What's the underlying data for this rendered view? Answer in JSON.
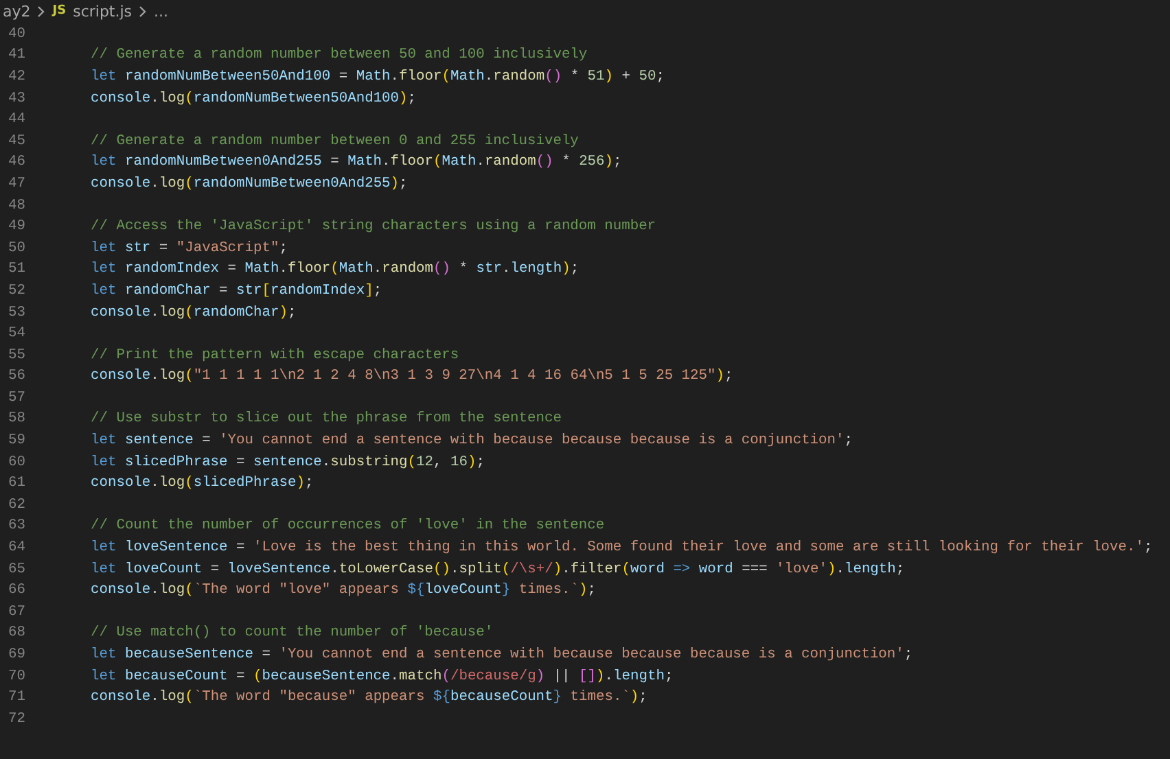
{
  "breadcrumb": {
    "folder": "ay2",
    "file_badge": "JS",
    "file": "script.js",
    "more": "..."
  },
  "lines": [
    {
      "number": "40"
    },
    {
      "number": "41",
      "tokens": [
        {
          "text": "// Generate a random number between 50 and 100 inclusively",
          "kind": "comment"
        }
      ]
    },
    {
      "number": "42",
      "tokens": [
        {
          "text": "let ",
          "kind": "keyword"
        },
        {
          "text": "randomNumBetween50And100",
          "kind": "variable"
        },
        {
          "text": " = ",
          "kind": "plain"
        },
        {
          "text": "Math",
          "kind": "variable"
        },
        {
          "text": ".",
          "kind": "plain"
        },
        {
          "text": "floor",
          "kind": "function"
        },
        {
          "text": "(",
          "kind": "bracket1"
        },
        {
          "text": "Math",
          "kind": "variable"
        },
        {
          "text": ".",
          "kind": "plain"
        },
        {
          "text": "random",
          "kind": "function"
        },
        {
          "text": "()",
          "kind": "bracket2"
        },
        {
          "text": " * ",
          "kind": "plain"
        },
        {
          "text": "51",
          "kind": "number"
        },
        {
          "text": ")",
          "kind": "bracket1"
        },
        {
          "text": " + ",
          "kind": "plain"
        },
        {
          "text": "50",
          "kind": "number"
        },
        {
          "text": ";",
          "kind": "plain"
        }
      ]
    },
    {
      "number": "43",
      "tokens": [
        {
          "text": "console",
          "kind": "variable"
        },
        {
          "text": ".",
          "kind": "plain"
        },
        {
          "text": "log",
          "kind": "function"
        },
        {
          "text": "(",
          "kind": "bracket1"
        },
        {
          "text": "randomNumBetween50And100",
          "kind": "variable"
        },
        {
          "text": ")",
          "kind": "bracket1"
        },
        {
          "text": ";",
          "kind": "plain"
        }
      ]
    },
    {
      "number": "44"
    },
    {
      "number": "45",
      "tokens": [
        {
          "text": "// Generate a random number between 0 and 255 inclusively",
          "kind": "comment"
        }
      ]
    },
    {
      "number": "46",
      "tokens": [
        {
          "text": "let ",
          "kind": "keyword"
        },
        {
          "text": "randomNumBetween0And255",
          "kind": "variable"
        },
        {
          "text": " = ",
          "kind": "plain"
        },
        {
          "text": "Math",
          "kind": "variable"
        },
        {
          "text": ".",
          "kind": "plain"
        },
        {
          "text": "floor",
          "kind": "function"
        },
        {
          "text": "(",
          "kind": "bracket1"
        },
        {
          "text": "Math",
          "kind": "variable"
        },
        {
          "text": ".",
          "kind": "plain"
        },
        {
          "text": "random",
          "kind": "function"
        },
        {
          "text": "()",
          "kind": "bracket2"
        },
        {
          "text": " * ",
          "kind": "plain"
        },
        {
          "text": "256",
          "kind": "number"
        },
        {
          "text": ")",
          "kind": "bracket1"
        },
        {
          "text": ";",
          "kind": "plain"
        }
      ]
    },
    {
      "number": "47",
      "tokens": [
        {
          "text": "console",
          "kind": "variable"
        },
        {
          "text": ".",
          "kind": "plain"
        },
        {
          "text": "log",
          "kind": "function"
        },
        {
          "text": "(",
          "kind": "bracket1"
        },
        {
          "text": "randomNumBetween0And255",
          "kind": "variable"
        },
        {
          "text": ")",
          "kind": "bracket1"
        },
        {
          "text": ";",
          "kind": "plain"
        }
      ]
    },
    {
      "number": "48"
    },
    {
      "number": "49",
      "tokens": [
        {
          "text": "// Access the 'JavaScript' string characters using a random number",
          "kind": "comment"
        }
      ]
    },
    {
      "number": "50",
      "tokens": [
        {
          "text": "let ",
          "kind": "keyword"
        },
        {
          "text": "str",
          "kind": "variable"
        },
        {
          "text": " = ",
          "kind": "plain"
        },
        {
          "text": "\"JavaScript\"",
          "kind": "string"
        },
        {
          "text": ";",
          "kind": "plain"
        }
      ]
    },
    {
      "number": "51",
      "tokens": [
        {
          "text": "let ",
          "kind": "keyword"
        },
        {
          "text": "randomIndex",
          "kind": "variable"
        },
        {
          "text": " = ",
          "kind": "plain"
        },
        {
          "text": "Math",
          "kind": "variable"
        },
        {
          "text": ".",
          "kind": "plain"
        },
        {
          "text": "floor",
          "kind": "function"
        },
        {
          "text": "(",
          "kind": "bracket1"
        },
        {
          "text": "Math",
          "kind": "variable"
        },
        {
          "text": ".",
          "kind": "plain"
        },
        {
          "text": "random",
          "kind": "function"
        },
        {
          "text": "()",
          "kind": "bracket2"
        },
        {
          "text": " * ",
          "kind": "plain"
        },
        {
          "text": "str",
          "kind": "variable"
        },
        {
          "text": ".",
          "kind": "plain"
        },
        {
          "text": "length",
          "kind": "variable"
        },
        {
          "text": ")",
          "kind": "bracket1"
        },
        {
          "text": ";",
          "kind": "plain"
        }
      ]
    },
    {
      "number": "52",
      "tokens": [
        {
          "text": "let ",
          "kind": "keyword"
        },
        {
          "text": "randomChar",
          "kind": "variable"
        },
        {
          "text": " = ",
          "kind": "plain"
        },
        {
          "text": "str",
          "kind": "variable"
        },
        {
          "text": "[",
          "kind": "bracket1"
        },
        {
          "text": "randomIndex",
          "kind": "variable"
        },
        {
          "text": "]",
          "kind": "bracket1"
        },
        {
          "text": ";",
          "kind": "plain"
        }
      ]
    },
    {
      "number": "53",
      "tokens": [
        {
          "text": "console",
          "kind": "variable"
        },
        {
          "text": ".",
          "kind": "plain"
        },
        {
          "text": "log",
          "kind": "function"
        },
        {
          "text": "(",
          "kind": "bracket1"
        },
        {
          "text": "randomChar",
          "kind": "variable"
        },
        {
          "text": ")",
          "kind": "bracket1"
        },
        {
          "text": ";",
          "kind": "plain"
        }
      ]
    },
    {
      "number": "54"
    },
    {
      "number": "55",
      "tokens": [
        {
          "text": "// Print the pattern with escape characters",
          "kind": "comment"
        }
      ]
    },
    {
      "number": "56",
      "tokens": [
        {
          "text": "console",
          "kind": "variable"
        },
        {
          "text": ".",
          "kind": "plain"
        },
        {
          "text": "log",
          "kind": "function"
        },
        {
          "text": "(",
          "kind": "bracket1"
        },
        {
          "text": "\"1 1 1 1 1\\n2 1 2 4 8\\n3 1 3 9 27\\n4 1 4 16 64\\n5 1 5 25 125\"",
          "kind": "string"
        },
        {
          "text": ")",
          "kind": "bracket1"
        },
        {
          "text": ";",
          "kind": "plain"
        }
      ]
    },
    {
      "number": "57"
    },
    {
      "number": "58",
      "tokens": [
        {
          "text": "// Use substr to slice out the phrase from the sentence",
          "kind": "comment"
        }
      ]
    },
    {
      "number": "59",
      "tokens": [
        {
          "text": "let ",
          "kind": "keyword"
        },
        {
          "text": "sentence",
          "kind": "variable"
        },
        {
          "text": " = ",
          "kind": "plain"
        },
        {
          "text": "'You cannot end a sentence with because because because is a conjunction'",
          "kind": "string"
        },
        {
          "text": ";",
          "kind": "plain"
        }
      ]
    },
    {
      "number": "60",
      "tokens": [
        {
          "text": "let ",
          "kind": "keyword"
        },
        {
          "text": "slicedPhrase",
          "kind": "variable"
        },
        {
          "text": " = ",
          "kind": "plain"
        },
        {
          "text": "sentence",
          "kind": "variable"
        },
        {
          "text": ".",
          "kind": "plain"
        },
        {
          "text": "substring",
          "kind": "function"
        },
        {
          "text": "(",
          "kind": "bracket1"
        },
        {
          "text": "12",
          "kind": "number"
        },
        {
          "text": ", ",
          "kind": "plain"
        },
        {
          "text": "16",
          "kind": "number"
        },
        {
          "text": ")",
          "kind": "bracket1"
        },
        {
          "text": ";",
          "kind": "plain"
        }
      ]
    },
    {
      "number": "61",
      "tokens": [
        {
          "text": "console",
          "kind": "variable"
        },
        {
          "text": ".",
          "kind": "plain"
        },
        {
          "text": "log",
          "kind": "function"
        },
        {
          "text": "(",
          "kind": "bracket1"
        },
        {
          "text": "slicedPhrase",
          "kind": "variable"
        },
        {
          "text": ")",
          "kind": "bracket1"
        },
        {
          "text": ";",
          "kind": "plain"
        }
      ]
    },
    {
      "number": "62"
    },
    {
      "number": "63",
      "tokens": [
        {
          "text": "// Count the number of occurrences of 'love' in the sentence",
          "kind": "comment"
        }
      ]
    },
    {
      "number": "64",
      "tokens": [
        {
          "text": "let ",
          "kind": "keyword"
        },
        {
          "text": "loveSentence",
          "kind": "variable"
        },
        {
          "text": " = ",
          "kind": "plain"
        },
        {
          "text": "'Love is the best thing in this world. Some found their love and some are still looking for their love.'",
          "kind": "string"
        },
        {
          "text": ";",
          "kind": "plain"
        }
      ]
    },
    {
      "number": "65",
      "tokens": [
        {
          "text": "let ",
          "kind": "keyword"
        },
        {
          "text": "loveCount",
          "kind": "variable"
        },
        {
          "text": " = ",
          "kind": "plain"
        },
        {
          "text": "loveSentence",
          "kind": "variable"
        },
        {
          "text": ".",
          "kind": "plain"
        },
        {
          "text": "toLowerCase",
          "kind": "function"
        },
        {
          "text": "()",
          "kind": "bracket1"
        },
        {
          "text": ".",
          "kind": "plain"
        },
        {
          "text": "split",
          "kind": "function"
        },
        {
          "text": "(",
          "kind": "bracket1"
        },
        {
          "text": "/\\s+/",
          "kind": "regex"
        },
        {
          "text": ")",
          "kind": "bracket1"
        },
        {
          "text": ".",
          "kind": "plain"
        },
        {
          "text": "filter",
          "kind": "function"
        },
        {
          "text": "(",
          "kind": "bracket1"
        },
        {
          "text": "word",
          "kind": "variable"
        },
        {
          "text": " => ",
          "kind": "keyword"
        },
        {
          "text": "word",
          "kind": "variable"
        },
        {
          "text": " === ",
          "kind": "plain"
        },
        {
          "text": "'love'",
          "kind": "string"
        },
        {
          "text": ")",
          "kind": "bracket1"
        },
        {
          "text": ".",
          "kind": "plain"
        },
        {
          "text": "length",
          "kind": "variable"
        },
        {
          "text": ";",
          "kind": "plain"
        }
      ]
    },
    {
      "number": "66",
      "tokens": [
        {
          "text": "console",
          "kind": "variable"
        },
        {
          "text": ".",
          "kind": "plain"
        },
        {
          "text": "log",
          "kind": "function"
        },
        {
          "text": "(",
          "kind": "bracket1"
        },
        {
          "text": "`The word \"love\" appears ",
          "kind": "string"
        },
        {
          "text": "${",
          "kind": "keyword"
        },
        {
          "text": "loveCount",
          "kind": "variable"
        },
        {
          "text": "}",
          "kind": "keyword"
        },
        {
          "text": " times.`",
          "kind": "string"
        },
        {
          "text": ")",
          "kind": "bracket1"
        },
        {
          "text": ";",
          "kind": "plain"
        }
      ]
    },
    {
      "number": "67"
    },
    {
      "number": "68",
      "tokens": [
        {
          "text": "// Use match() to count the number of 'because'",
          "kind": "comment"
        }
      ]
    },
    {
      "number": "69",
      "tokens": [
        {
          "text": "let ",
          "kind": "keyword"
        },
        {
          "text": "becauseSentence",
          "kind": "variable"
        },
        {
          "text": " = ",
          "kind": "plain"
        },
        {
          "text": "'You cannot end a sentence with because because because is a conjunction'",
          "kind": "string"
        },
        {
          "text": ";",
          "kind": "plain"
        }
      ]
    },
    {
      "number": "70",
      "tokens": [
        {
          "text": "let ",
          "kind": "keyword"
        },
        {
          "text": "becauseCount",
          "kind": "variable"
        },
        {
          "text": " = ",
          "kind": "plain"
        },
        {
          "text": "(",
          "kind": "bracket1"
        },
        {
          "text": "becauseSentence",
          "kind": "variable"
        },
        {
          "text": ".",
          "kind": "plain"
        },
        {
          "text": "match",
          "kind": "function"
        },
        {
          "text": "(",
          "kind": "bracket2"
        },
        {
          "text": "/because/g",
          "kind": "regex"
        },
        {
          "text": ")",
          "kind": "bracket2"
        },
        {
          "text": " || ",
          "kind": "plain"
        },
        {
          "text": "[]",
          "kind": "bracket2"
        },
        {
          "text": ")",
          "kind": "bracket1"
        },
        {
          "text": ".",
          "kind": "plain"
        },
        {
          "text": "length",
          "kind": "variable"
        },
        {
          "text": ";",
          "kind": "plain"
        }
      ]
    },
    {
      "number": "71",
      "tokens": [
        {
          "text": "console",
          "kind": "variable"
        },
        {
          "text": ".",
          "kind": "plain"
        },
        {
          "text": "log",
          "kind": "function"
        },
        {
          "text": "(",
          "kind": "bracket1"
        },
        {
          "text": "`The word \"because\" appears ",
          "kind": "string"
        },
        {
          "text": "${",
          "kind": "keyword"
        },
        {
          "text": "becauseCount",
          "kind": "variable"
        },
        {
          "text": "}",
          "kind": "keyword"
        },
        {
          "text": " times.`",
          "kind": "string"
        },
        {
          "text": ")",
          "kind": "bracket1"
        },
        {
          "text": ";",
          "kind": "plain"
        }
      ]
    },
    {
      "number": "72"
    }
  ]
}
